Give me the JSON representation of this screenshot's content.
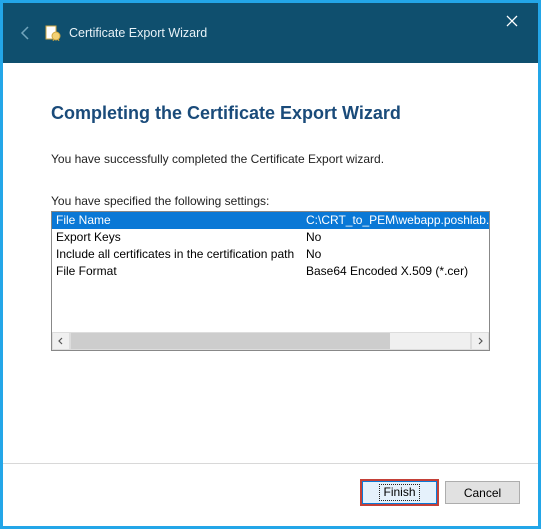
{
  "titlebar": {
    "title": "Certificate Export Wizard"
  },
  "content": {
    "heading": "Completing the Certificate Export Wizard",
    "status": "You have successfully completed the Certificate Export wizard.",
    "settings_label": "You have specified the following settings:",
    "columns": {
      "name": "File Name",
      "value": "C:\\CRT_to_PEM\\webapp.poshlab.xyz."
    },
    "rows": [
      {
        "label": "Export Keys",
        "value": "No"
      },
      {
        "label": "Include all certificates in the certification path",
        "value": "No"
      },
      {
        "label": "File Format",
        "value": "Base64 Encoded X.509 (*.cer)"
      }
    ]
  },
  "footer": {
    "finish": "Finish",
    "cancel": "Cancel"
  }
}
